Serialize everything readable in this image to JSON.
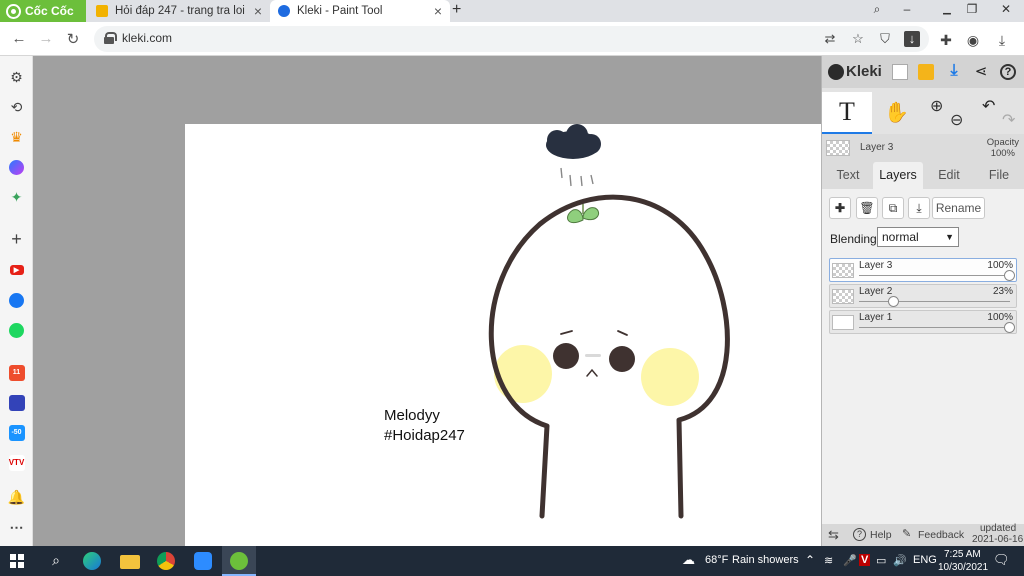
{
  "browser": {
    "brand": "Cốc Cốc",
    "tabs": [
      {
        "title": "Hỏi đáp 247 - trang tra loi",
        "active": false
      },
      {
        "title": "Kleki - Paint Tool",
        "active": true
      }
    ],
    "url": "kleki.com"
  },
  "canvas": {
    "signature_line1": "Melodyy",
    "signature_line2": "#Hoidap247"
  },
  "panel": {
    "brand": "Kleki",
    "tool_text_label": "T",
    "current_layer": "Layer 3",
    "opacity_label": "Opacity",
    "opacity_value": "100%",
    "tabs": [
      "Text",
      "Layers",
      "Edit",
      "File"
    ],
    "active_tab": "Layers",
    "rename_label": "Rename",
    "blending_label": "Blending",
    "blending_value": "normal",
    "layers": [
      {
        "name": "Layer 3",
        "opacity": "100%",
        "opacity_fraction": 1.0,
        "selected": true
      },
      {
        "name": "Layer 2",
        "opacity": "23%",
        "opacity_fraction": 0.23,
        "selected": false
      },
      {
        "name": "Layer 1",
        "opacity": "100%",
        "opacity_fraction": 1.0,
        "selected": false
      }
    ],
    "footer": {
      "help": "Help",
      "feedback": "Feedback",
      "updated_label": "updated",
      "updated_date": "2021-06-16"
    }
  },
  "taskbar": {
    "weather_temp": "68°F",
    "weather_desc": "Rain showers",
    "language": "ENG",
    "time": "7:25 AM",
    "date": "10/30/2021"
  },
  "colors": {
    "accent_blue": "#1e7ae6",
    "brand_green": "#6cbf3b",
    "taskbar": "#1f2a38"
  }
}
